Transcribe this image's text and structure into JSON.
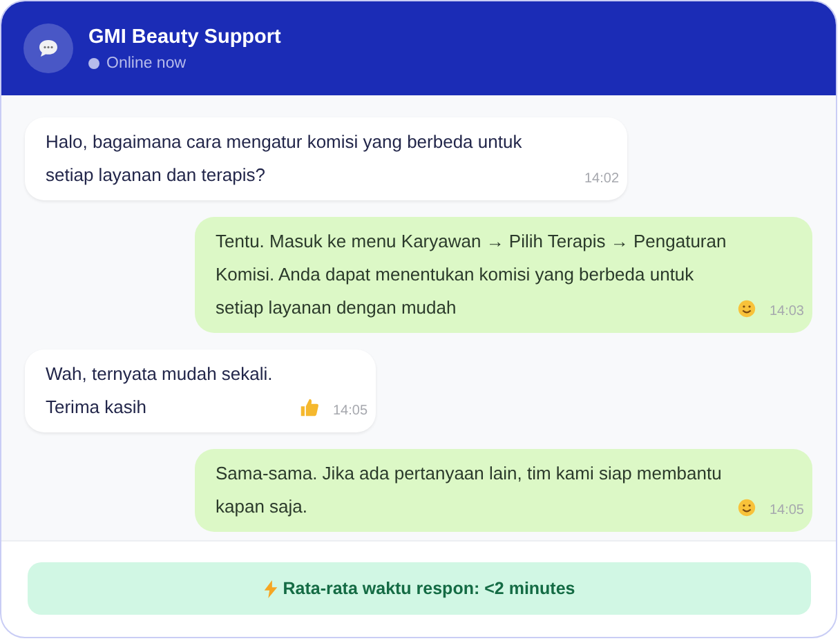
{
  "header": {
    "title": "GMI Beauty Support",
    "status": "Online now",
    "online": true
  },
  "messages": [
    {
      "kind": "question",
      "text": "Halo, bagaimana cara mengatur komisi yang berbeda untuk setiap layanan dan terapis?",
      "time": "14:02"
    },
    {
      "kind": "reply",
      "text": "Tentu. Masuk ke menu Karyawan → Pilih Terapis → Pengaturan Komisi. Anda dapat menentukan komisi yang berbeda untuk setiap layanan dengan mudah",
      "time": "14:03"
    },
    {
      "kind": "thanks",
      "text": "Wah, ternyata mudah sekali. Terima kasih",
      "time": "14:05"
    },
    {
      "kind": "reply",
      "text": "Sama-sama. Jika ada pertanyaan lain, tim kami siap membantu kapan saja.",
      "time": "14:05"
    }
  ],
  "banner": {
    "text": "Rata-rata waktu respon: <2 minutes"
  }
}
